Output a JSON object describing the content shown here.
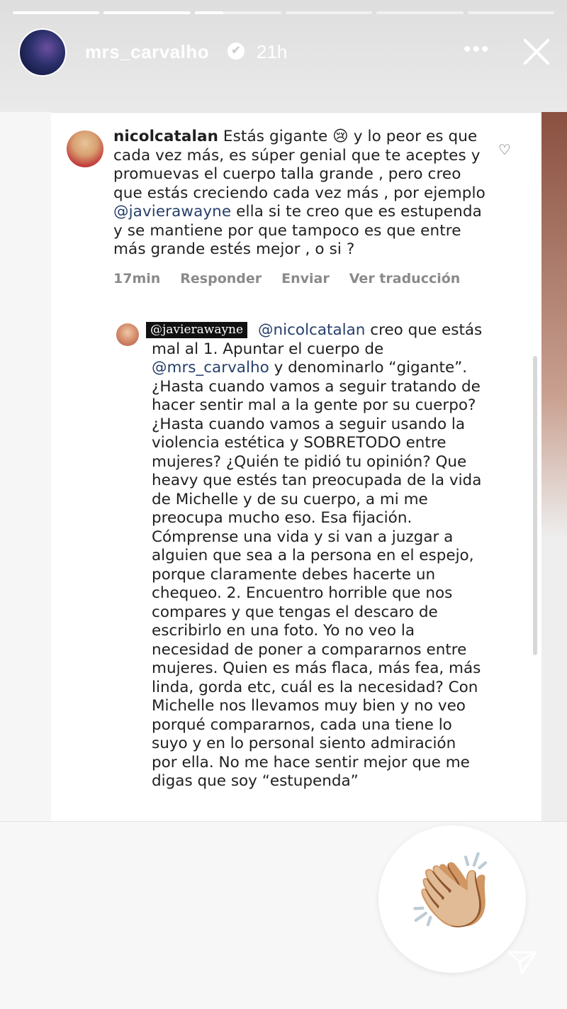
{
  "story": {
    "progress_segments": [
      1.0,
      1.0,
      0.33,
      0,
      0,
      0
    ],
    "username": "mrs_carvalho",
    "verified_glyph": "✔",
    "time": "21h",
    "more_glyph": "•••"
  },
  "comment": {
    "username": "nicolcatalan",
    "text_before_mention": "Estás gigante 😢 y lo peor es que cada vez más, es súper genial que te aceptes y promuevas el cuerpo talla grande , pero creo que estás creciendo cada vez más , por ejemplo ",
    "mention": "@javierawayne",
    "text_after_mention": " ella si te creo que es estupenda y se mantiene por que tampoco es que entre más grande estés mejor , o si ?",
    "meta": [
      "17min",
      "Responder",
      "Enviar",
      "Ver traducción"
    ]
  },
  "reply": {
    "tag": "@javierawayne",
    "mention_1": "@nicolcatalan",
    "text_1": " creo que estás mal al 1. Apuntar el cuerpo de ",
    "mention_2": "@mrs_carvalho",
    "text_2": " y denominarlo “gigante”. ¿Hasta cuando vamos a seguir tratando de hacer sentir mal a la gente por su cuerpo? ¿Hasta cuando vamos a seguir usando la violencia estética y SOBRETODO entre mujeres? ¿Quién te pidió tu opinión? Que heavy que estés tan preocupada de la vida de Michelle y de su cuerpo, a mi me preocupa mucho eso. Esa fijación. Cómprense una vida y si van a juzgar a alguien que sea a la persona en el espejo, porque claramente debes hacerte un chequeo. 2. Encuentro horrible que nos compares y que tengas el descaro de escribirlo en una foto. Yo no veo la necesidad de poner a compararnos entre mujeres. Quien es más flaca, más fea, más linda, gorda etc, cuál es la necesidad? Con Michelle nos llevamos muy bien y no veo porqué compararnos, cada una tiene lo suyo y en lo personal siento admiración por ella. No me hace sentir mejor que me digas que soy “estupenda”"
  },
  "sticker": {
    "emoji": "👏🏼",
    "icon": "clapping-hands-icon"
  },
  "colors": {
    "mention": "#263f6a",
    "meta": "#8a8a8a"
  }
}
